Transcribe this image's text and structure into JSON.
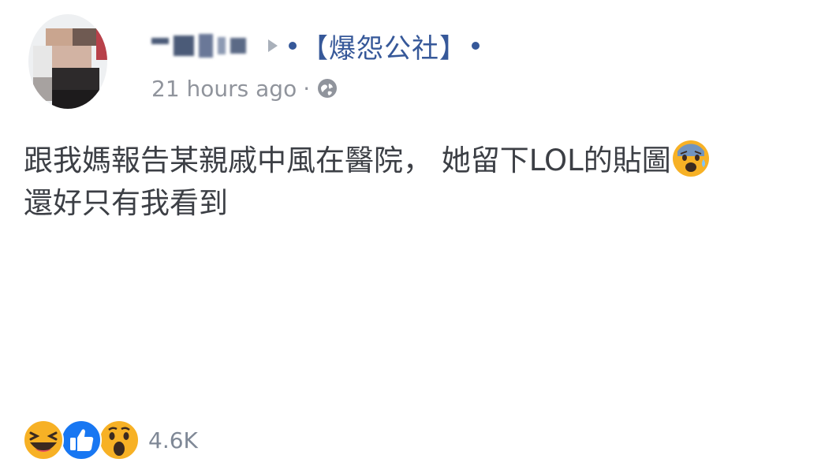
{
  "post": {
    "author": {
      "name": "",
      "avatar": "blurred-profile-photo"
    },
    "group": {
      "name": "【爆怨公社】"
    },
    "timestamp": "21 hours ago",
    "separator": "·",
    "privacy_icon": "globe-icon",
    "text_line_1": "跟我媽報告某親戚中風在醫院， 她留下LOL的貼圖",
    "text_line_2": "還好只有我看到",
    "inline_emoji": "anxious-face-with-sweat-icon"
  },
  "reactions": {
    "icons": [
      "haha-reaction-icon",
      "like-reaction-icon",
      "wow-reaction-icon"
    ],
    "count": "4.6K"
  },
  "colors": {
    "link": "#365899",
    "meta": "#90949c",
    "text": "#3c3f45",
    "like_blue": "#1877f2",
    "emoji_yellow": "#f7b125"
  }
}
